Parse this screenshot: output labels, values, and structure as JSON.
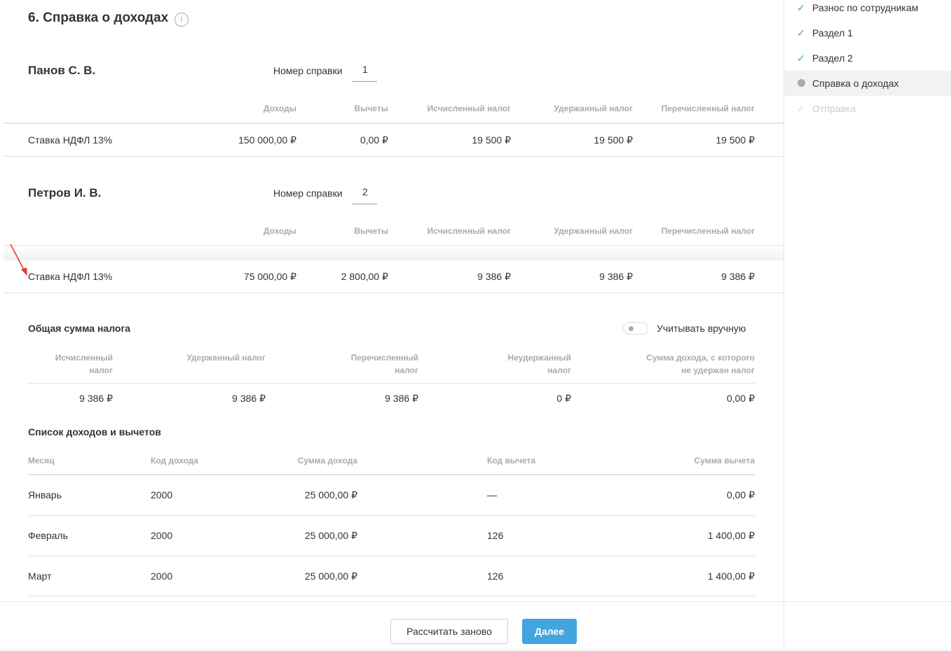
{
  "page": {
    "title": "6. Справка о доходах"
  },
  "columns": [
    "Доходы",
    "Вычеты",
    "Исчисленный налог",
    "Удержанный налог",
    "Перечисленный налог"
  ],
  "employees": [
    {
      "name": "Панов С. В.",
      "cert_label": "Номер справки",
      "cert_number": "1",
      "row": {
        "label": "Ставка НДФЛ 13%",
        "values": [
          "150 000,00 ₽",
          "0,00 ₽",
          "19 500 ₽",
          "19 500 ₽",
          "19 500 ₽"
        ]
      }
    },
    {
      "name": "Петров И. В.",
      "cert_label": "Номер справки",
      "cert_number": "2",
      "row": {
        "label": "Ставка НДФЛ 13%",
        "values": [
          "75 000,00 ₽",
          "2 800,00 ₽",
          "9 386 ₽",
          "9 386 ₽",
          "9 386 ₽"
        ]
      }
    }
  ],
  "summary": {
    "title": "Общая сумма налога",
    "toggle_label": "Учитывать вручную",
    "toggle_on": false,
    "headers": [
      [
        "Исчисленный",
        "налог"
      ],
      [
        "Удержанный налог",
        ""
      ],
      [
        "Перечисленный",
        "налог"
      ],
      [
        "Неудержанный",
        "налог"
      ],
      [
        "Сумма дохода, с которого",
        "не удержан налог"
      ]
    ],
    "values": [
      "9 386 ₽",
      "9 386 ₽",
      "9 386 ₽",
      "0 ₽",
      "0,00 ₽"
    ]
  },
  "income_list": {
    "title": "Список доходов и вычетов",
    "headers": [
      "Месяц",
      "Код дохода",
      "Сумма дохода",
      "Код вычета",
      "Сумма вычета"
    ],
    "rows": [
      [
        "Январь",
        "2000",
        "25 000,00 ₽",
        "—",
        "0,00 ₽"
      ],
      [
        "Февраль",
        "2000",
        "25 000,00 ₽",
        "126",
        "1 400,00 ₽"
      ],
      [
        "Март",
        "2000",
        "25 000,00 ₽",
        "126",
        "1 400,00 ₽"
      ]
    ]
  },
  "sidebar": {
    "items": [
      {
        "label": "Разнос по сотрудникам",
        "state": "done"
      },
      {
        "label": "Раздел 1",
        "state": "done"
      },
      {
        "label": "Раздел 2",
        "state": "done"
      },
      {
        "label": "Справка о доходах",
        "state": "current"
      },
      {
        "label": "Отправка",
        "state": "pending"
      }
    ]
  },
  "footer": {
    "recalc": "Рассчитать заново",
    "next": "Далее"
  },
  "colors": {
    "accent": "#42a5e0",
    "check": "#3cb878",
    "arrow": "#e53935"
  }
}
